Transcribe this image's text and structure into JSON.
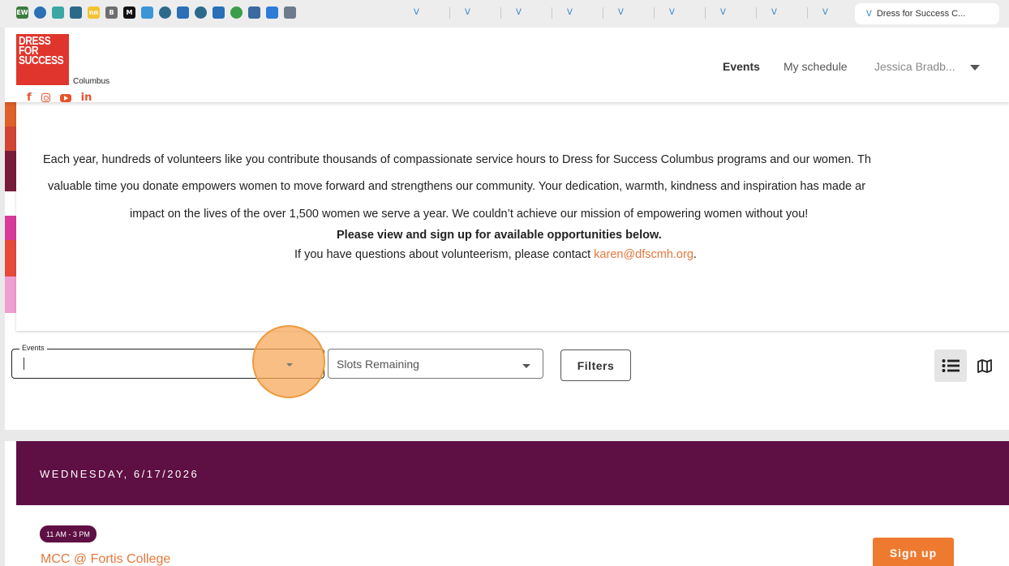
{
  "browser": {
    "active_tab_title": "Dress for Success C...",
    "favicons": [
      {
        "label": "EW",
        "color": "#3d7c3f"
      },
      {
        "label": "",
        "color": "#2b6fb6"
      },
      {
        "label": "",
        "color": "#3aa7a3"
      },
      {
        "label": "",
        "color": "#2d6a8a"
      },
      {
        "label": "nn",
        "color": "#f3c332"
      },
      {
        "label": "B",
        "color": "#6e6e6e"
      },
      {
        "label": "M",
        "color": "#111111"
      },
      {
        "label": "",
        "color": "#3b95d6"
      },
      {
        "label": "",
        "color": "#2d6a8a"
      },
      {
        "label": "",
        "color": "#2b6fb6"
      },
      {
        "label": "",
        "color": "#2d6a8a"
      },
      {
        "label": "",
        "color": "#2b6fb6"
      },
      {
        "label": "",
        "color": "#3a9d4a"
      },
      {
        "label": "",
        "color": "#3b6aa0"
      },
      {
        "label": "",
        "color": "#2f7bd8"
      },
      {
        "label": "",
        "color": "#6e7b8a"
      }
    ]
  },
  "header": {
    "logo_lines": [
      "DRESS",
      "FOR",
      "SUCCESS"
    ],
    "logo_sub": "Columbus",
    "nav": {
      "events": "Events",
      "schedule": "My schedule",
      "user": "Jessica Bradb..."
    }
  },
  "intro": {
    "social": [
      "facebook-icon",
      "instagram-icon",
      "youtube-icon",
      "linkedin-icon"
    ],
    "lines": [
      "Each year, hundreds of volunteers like you contribute thousands of compassionate service hours to Dress for Success Columbus programs and our women. Th",
      "valuable time you donate empowers women to move forward and strengthens our community. Your dedication, warmth, kindness and inspiration has made ar",
      "impact on the lives of the over 1,500 women we serve a year. We couldn’t achieve our mission of empowering women without you!"
    ],
    "bold_line": "Please view and sign up for available opportunities below.",
    "contact_prefix": "If you have questions about volunteerism, please contact ",
    "contact_email": "karen@dfscmh.org",
    "contact_suffix": "."
  },
  "filters": {
    "events_label": "Events",
    "events_value": "",
    "slots_placeholder": "Slots Remaining",
    "filters_button": "Filters"
  },
  "schedule": {
    "day_header": "WEDNESDAY, 6/17/2026",
    "events": [
      {
        "time": "11 AM - 3 PM",
        "title": "MCC @ Fortis College",
        "action": "Sign up"
      }
    ]
  },
  "colors": {
    "brand_red": "#e0352c",
    "accent_orange": "#e5773a",
    "day_bar": "#5e0f43",
    "signup": "#ee7a30"
  }
}
